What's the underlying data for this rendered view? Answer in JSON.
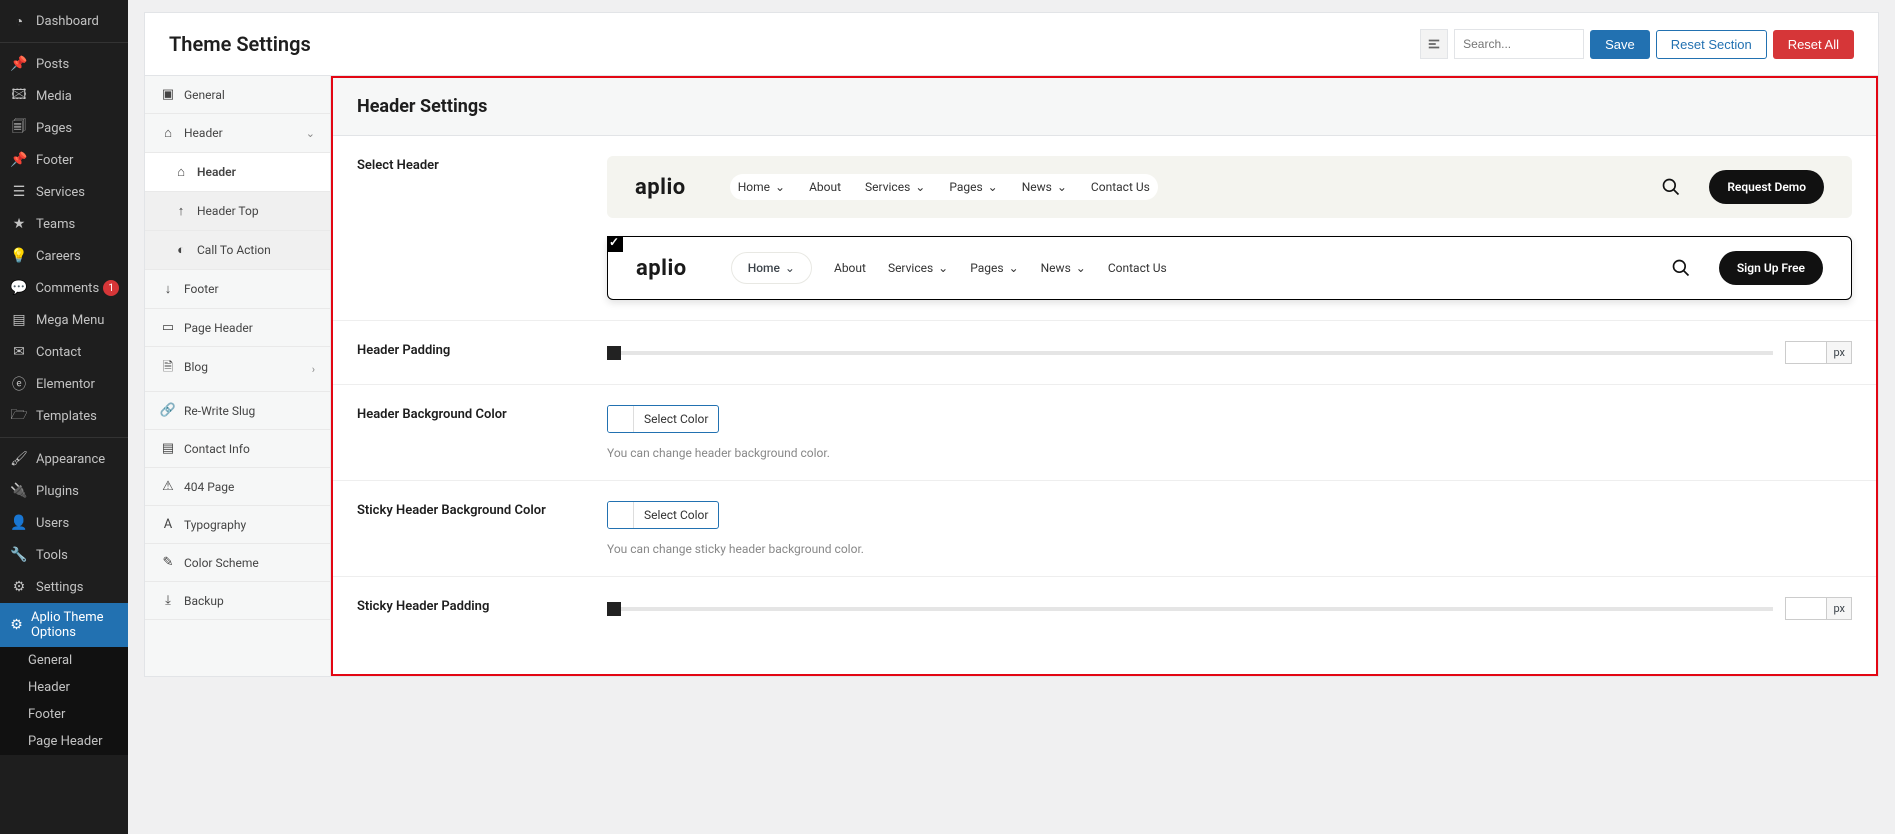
{
  "wp_menu": {
    "dashboard": "Dashboard",
    "posts": "Posts",
    "media": "Media",
    "pages": "Pages",
    "footer": "Footer",
    "services": "Services",
    "teams": "Teams",
    "careers": "Careers",
    "comments": "Comments",
    "comments_count": "1",
    "mega_menu": "Mega Menu",
    "contact": "Contact",
    "elementor": "Elementor",
    "templates": "Templates",
    "appearance": "Appearance",
    "plugins": "Plugins",
    "users": "Users",
    "tools": "Tools",
    "settings": "Settings",
    "theme_options": "Aplio Theme Options",
    "sub_general": "General",
    "sub_header": "Header",
    "sub_footer": "Footer",
    "sub_page_header": "Page Header"
  },
  "page": {
    "title": "Theme Settings",
    "search_placeholder": "Search...",
    "save": "Save",
    "reset_section": "Reset Section",
    "reset_all": "Reset All"
  },
  "side": {
    "general": "General",
    "header": "Header",
    "header_sub": "Header",
    "header_top": "Header Top",
    "call_to_action": "Call To Action",
    "footer": "Footer",
    "page_header": "Page Header",
    "blog": "Blog",
    "rewrite": "Re-Write Slug",
    "contact_info": "Contact Info",
    "p404": "404 Page",
    "typography": "Typography",
    "color_scheme": "Color Scheme",
    "backup": "Backup"
  },
  "settings": {
    "header_title": "Header Settings",
    "select_header": "Select Header",
    "header_padding": "Header Padding",
    "header_bg": "Header Background Color",
    "header_bg_help": "You can change header background color.",
    "sticky_bg": "Sticky Header Background Color",
    "sticky_bg_help": "You can change sticky header background color.",
    "sticky_padding": "Sticky Header Padding",
    "select_color": "Select Color",
    "unit": "px"
  },
  "preview": {
    "logo": "aplio",
    "nav": {
      "home": "Home",
      "about": "About",
      "services": "Services",
      "pages": "Pages",
      "news": "News",
      "contact": "Contact Us"
    },
    "cta1": "Request Demo",
    "cta2": "Sign Up Free"
  }
}
